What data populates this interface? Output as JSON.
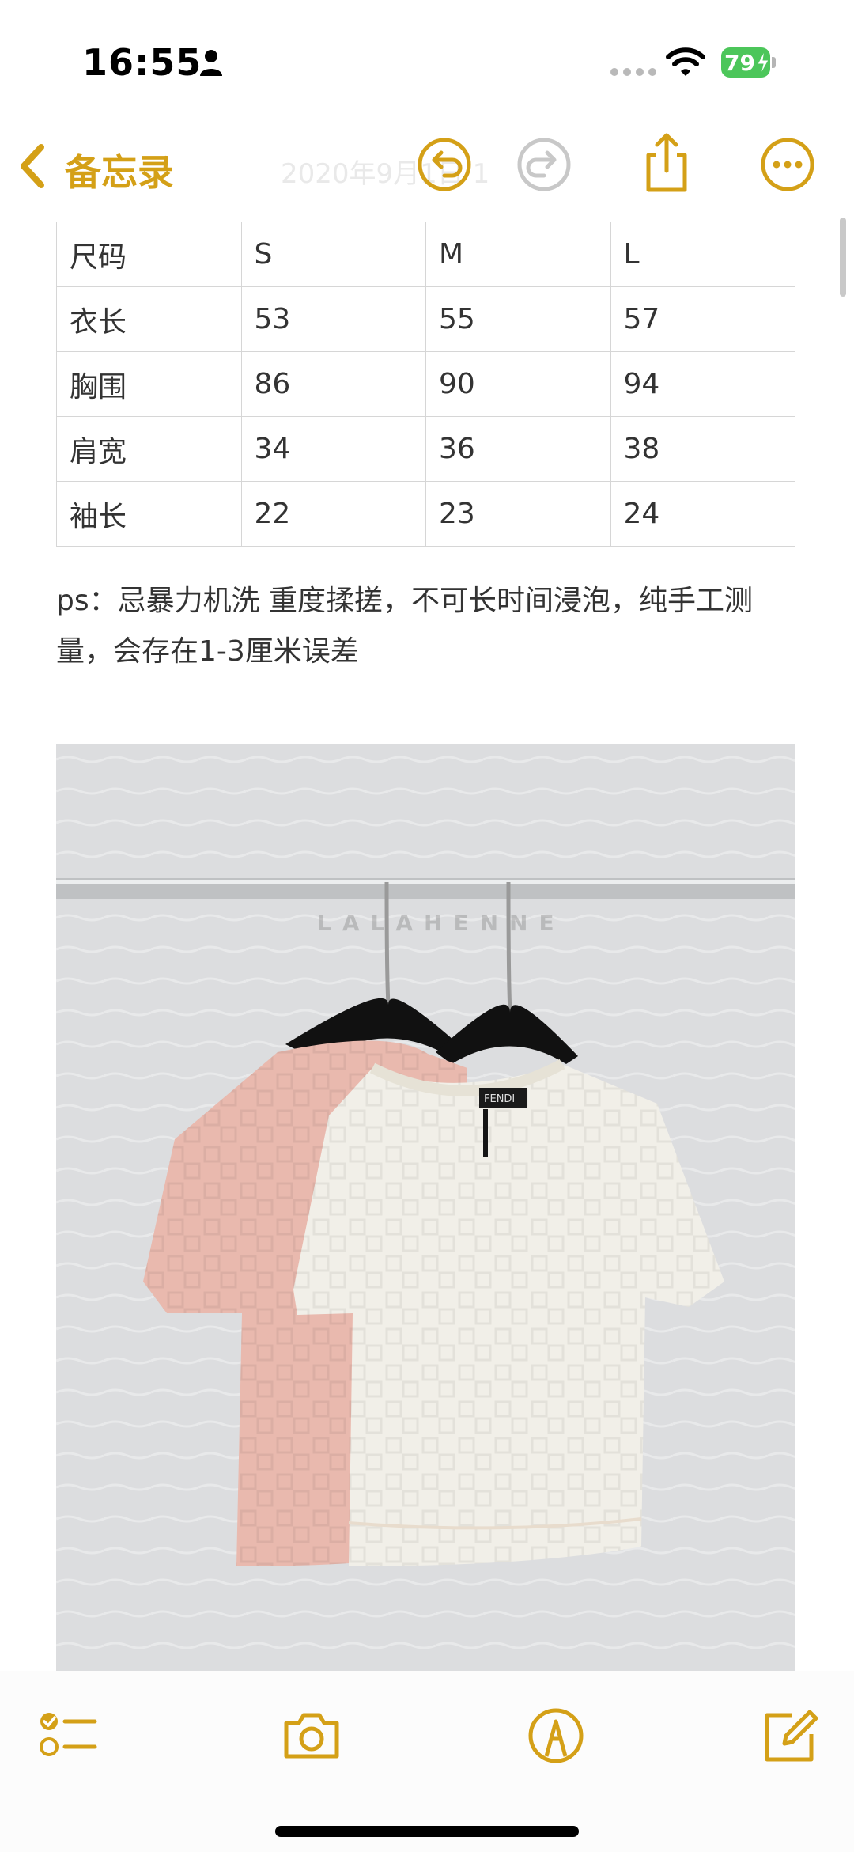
{
  "status_bar": {
    "time": "16:55",
    "battery": "79",
    "icons": [
      "person-icon",
      "wifi-icon",
      "battery-icon"
    ]
  },
  "nav": {
    "back_label": "备忘录",
    "faded_date": "2020年9月1日 1",
    "icons": [
      "chevron-left-icon",
      "undo-icon",
      "redo-icon",
      "share-icon",
      "more-icon"
    ],
    "accent_color": "#d4a017"
  },
  "size_table": {
    "rows": [
      [
        "尺码",
        "S",
        "M",
        "L"
      ],
      [
        "衣长",
        "53",
        "55",
        "57"
      ],
      [
        "胸围",
        "86",
        "90",
        "94"
      ],
      [
        "肩宽",
        "34",
        "36",
        "38"
      ],
      [
        "袖长",
        "22",
        "23",
        "24"
      ]
    ]
  },
  "note": {
    "text": "ps：忌暴力机洗 重度揉搓，不可长时间浸泡，纯手工测量，会存在1-3厘米误差"
  },
  "photo": {
    "watermark": "LALAHENNE",
    "label_text": "FENDI"
  },
  "toolbar": {
    "icons": [
      "checklist-icon",
      "camera-icon",
      "markup-icon",
      "compose-icon"
    ]
  }
}
